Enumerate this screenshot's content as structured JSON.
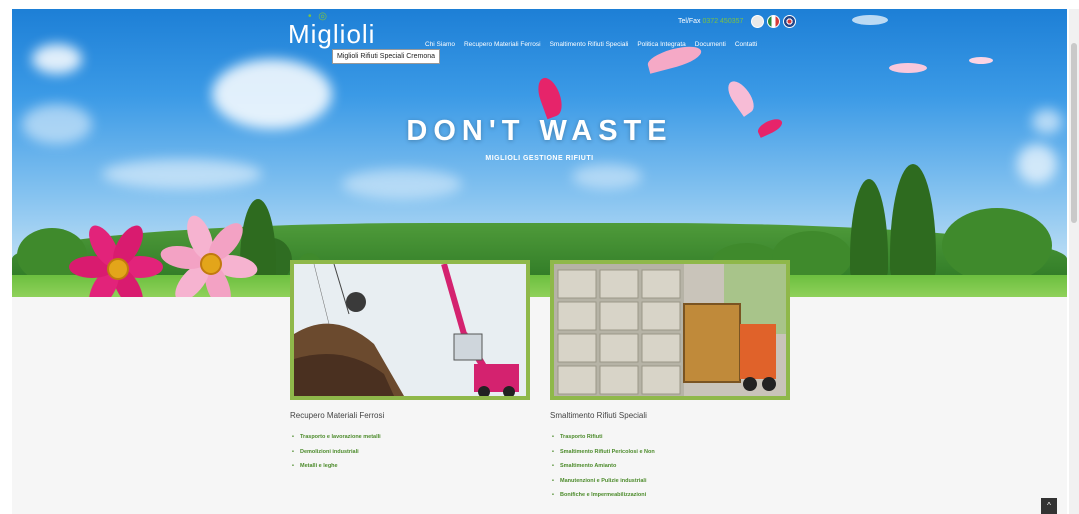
{
  "logo": {
    "text": "Miglioli",
    "tooltip": "Miglioli Rifiuti Speciali Cremona"
  },
  "topbar": {
    "phone_label": "Tel/Fax",
    "phone_number": "0372 450357"
  },
  "nav": {
    "items": [
      {
        "label": "Chi Siamo"
      },
      {
        "label": "Recupero Materiali Ferrosi"
      },
      {
        "label": "Smaltimento Rifiuti Speciali"
      },
      {
        "label": "Politica Integrata"
      },
      {
        "label": "Documenti"
      },
      {
        "label": "Contatti"
      }
    ]
  },
  "hero": {
    "headline": "DON'T WASTE",
    "subheadline": "MIGLIOLI GESTIONE RIFIUTI"
  },
  "cards": [
    {
      "title": "Recupero Materiali Ferrosi",
      "items": [
        "Trasporto e lavorazione metalli",
        "Demolizioni industriali",
        "Metalli e leghe"
      ]
    },
    {
      "title": "Smaltimento Rifiuti Speciali",
      "items": [
        "Trasporto Rifiuti",
        "Smaltimento Rifiuti Pericolosi e Non",
        "Smaltimento Amianto",
        "Manutenzioni e Pulizie industriali",
        "Bonifiche e Impermeabilizzazioni"
      ]
    }
  ],
  "icons": {
    "flags": [
      "email-icon",
      "italy-flag-icon",
      "uk-flag-icon"
    ],
    "to_top": "chevron-up-icon"
  },
  "colors": {
    "accent_green": "#7cc242",
    "border_green": "#8fb84a",
    "link_green": "#4c8b2b"
  }
}
